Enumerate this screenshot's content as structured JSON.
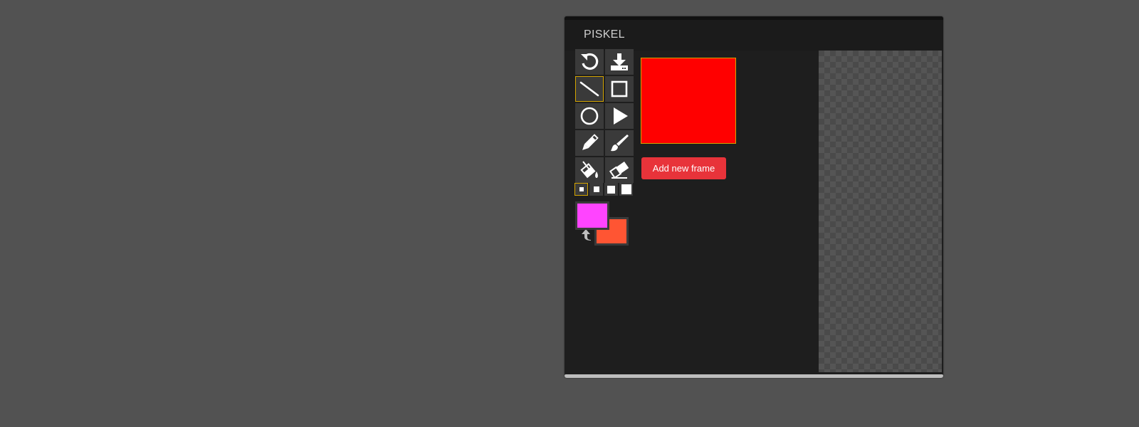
{
  "app": {
    "title": "PISKEL"
  },
  "tools": [
    {
      "name": "undo",
      "icon": "undo-icon"
    },
    {
      "name": "export",
      "icon": "download-icon"
    },
    {
      "name": "line",
      "icon": "line-icon",
      "selected": true
    },
    {
      "name": "rectangle",
      "icon": "square-icon"
    },
    {
      "name": "circle",
      "icon": "circle-icon"
    },
    {
      "name": "play",
      "icon": "play-icon"
    },
    {
      "name": "pencil",
      "icon": "pencil-icon"
    },
    {
      "name": "brush",
      "icon": "brush-icon"
    },
    {
      "name": "paint-bucket",
      "icon": "paint-bucket-icon"
    },
    {
      "name": "eraser",
      "icon": "eraser-icon"
    }
  ],
  "pen_sizes": [
    1,
    2,
    3,
    4
  ],
  "selected_pen_size": 1,
  "colors": {
    "primary": "#ff44ff",
    "secondary": "#ff5533",
    "frame_fill": "#ff0000",
    "accent": "#d4a400",
    "button": "#e8333a"
  },
  "frames": {
    "add_label": "Add new frame"
  }
}
